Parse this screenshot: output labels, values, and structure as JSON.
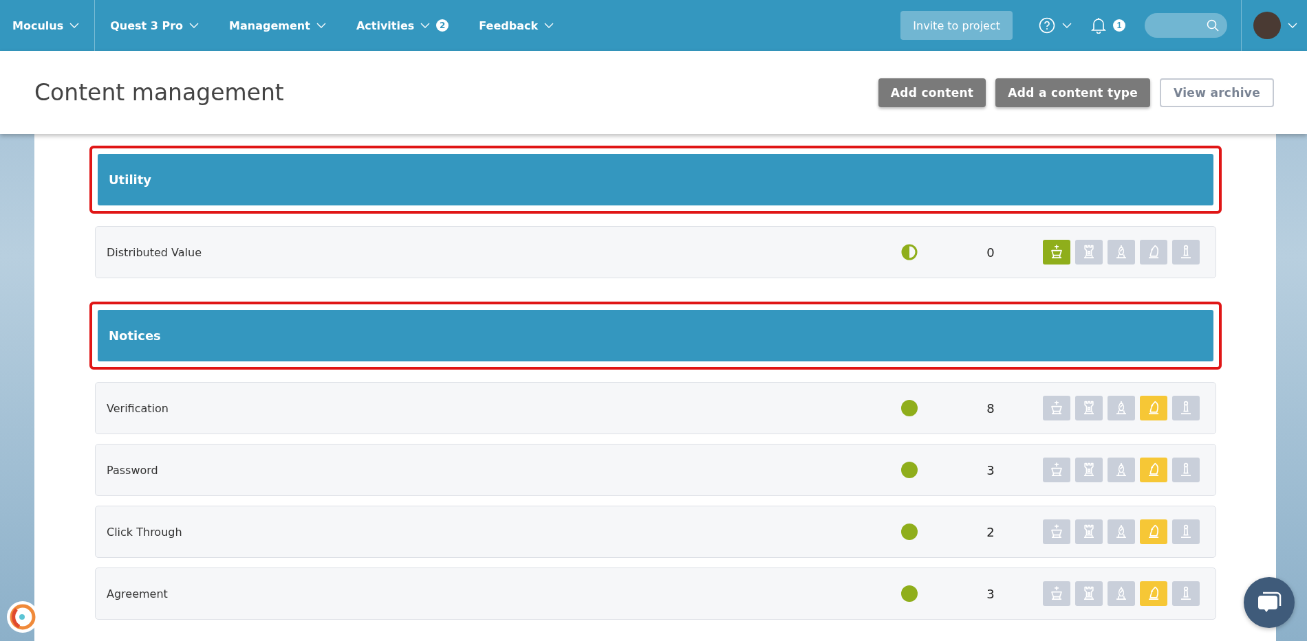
{
  "nav": {
    "menus": [
      {
        "label": "Moculus"
      },
      {
        "label": "Quest 3 Pro"
      },
      {
        "label": "Management"
      },
      {
        "label": "Activities",
        "badge": "2"
      },
      {
        "label": "Feedback"
      }
    ],
    "invite_button": "Invite to project",
    "notifications_badge": "1"
  },
  "header": {
    "title": "Content management",
    "buttons": [
      {
        "label": "Add content",
        "kind": "filled"
      },
      {
        "label": "Add a content type",
        "kind": "filled"
      },
      {
        "label": "View archive",
        "kind": "outline"
      }
    ]
  },
  "groups": [
    {
      "title": "Utility",
      "highlighted": true,
      "rows": [
        {
          "name": "Distributed Value",
          "kind": "half",
          "count": "0",
          "pieces": [
            {
              "kind": "king",
              "color": "#8fae1b"
            },
            {
              "kind": "rook",
              "color": "#c9cfda"
            },
            {
              "kind": "bishop",
              "color": "#c9cfda"
            },
            {
              "kind": "knight",
              "color": "#c9cfda"
            },
            {
              "kind": "pawn",
              "color": "#c9cfda"
            }
          ]
        }
      ]
    },
    {
      "title": "Notices",
      "highlighted": true,
      "rows": [
        {
          "name": "Verification",
          "kind": "full",
          "count": "8",
          "pieces": [
            {
              "kind": "king",
              "color": "#c9cfda"
            },
            {
              "kind": "rook",
              "color": "#c9cfda"
            },
            {
              "kind": "bishop",
              "color": "#c9cfda"
            },
            {
              "kind": "knight",
              "color": "#f6c736"
            },
            {
              "kind": "pawn",
              "color": "#c9cfda"
            }
          ]
        },
        {
          "name": "Password",
          "kind": "full",
          "count": "3",
          "pieces": [
            {
              "kind": "king",
              "color": "#c9cfda"
            },
            {
              "kind": "rook",
              "color": "#c9cfda"
            },
            {
              "kind": "bishop",
              "color": "#c9cfda"
            },
            {
              "kind": "knight",
              "color": "#f6c736"
            },
            {
              "kind": "pawn",
              "color": "#c9cfda"
            }
          ]
        },
        {
          "name": "Click Through",
          "kind": "full",
          "count": "2",
          "pieces": [
            {
              "kind": "king",
              "color": "#c9cfda"
            },
            {
              "kind": "rook",
              "color": "#c9cfda"
            },
            {
              "kind": "bishop",
              "color": "#c9cfda"
            },
            {
              "kind": "knight",
              "color": "#f6c736"
            },
            {
              "kind": "pawn",
              "color": "#c9cfda"
            }
          ]
        },
        {
          "name": "Agreement",
          "kind": "full",
          "count": "3",
          "pieces": [
            {
              "kind": "king",
              "color": "#c9cfda"
            },
            {
              "kind": "rook",
              "color": "#c9cfda"
            },
            {
              "kind": "bishop",
              "color": "#c9cfda"
            },
            {
              "kind": "knight",
              "color": "#f6c736"
            },
            {
              "kind": "pawn",
              "color": "#c9cfda"
            }
          ]
        }
      ]
    }
  ]
}
